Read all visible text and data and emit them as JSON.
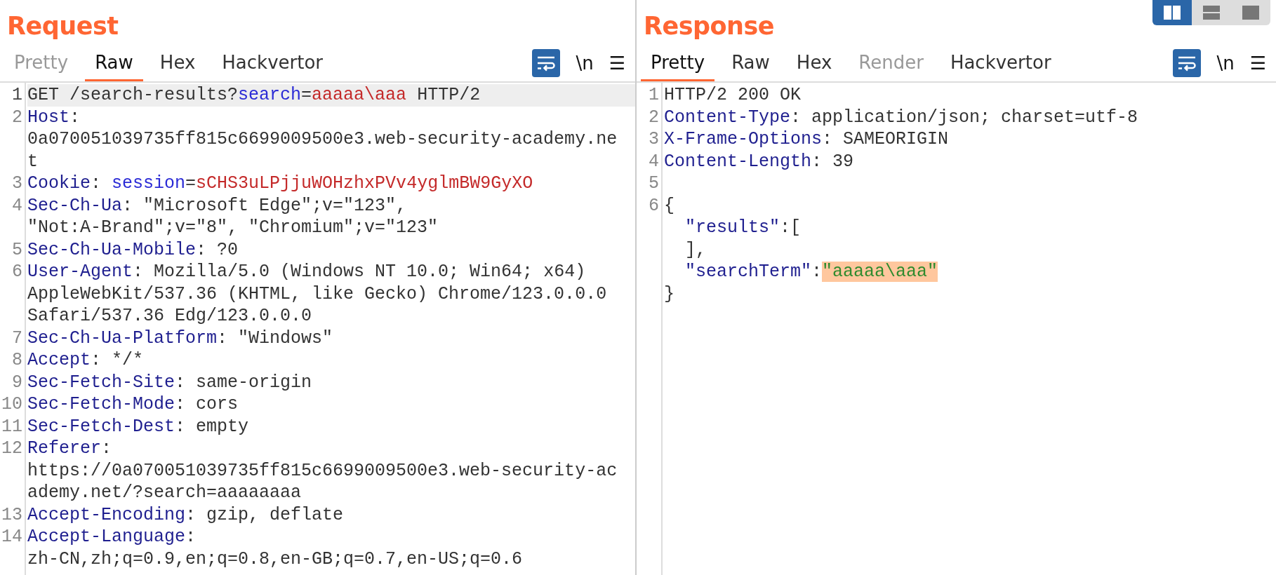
{
  "layout_buttons": [
    {
      "kind": "columns",
      "selected": true
    },
    {
      "kind": "rows",
      "selected": false
    },
    {
      "kind": "single",
      "selected": false
    }
  ],
  "panes": [
    {
      "title": "Request",
      "tabs": [
        {
          "label": "Pretty",
          "selected": false,
          "disabled": true
        },
        {
          "label": "Raw",
          "selected": true,
          "disabled": false
        },
        {
          "label": "Hex",
          "selected": false,
          "disabled": false
        },
        {
          "label": "Hackvertor",
          "selected": false,
          "disabled": false
        }
      ],
      "toolbar": {
        "word_wrap": true,
        "newline_label": "\\n",
        "menu_label": "☰"
      },
      "lines": [
        {
          "number": "1",
          "selected": true,
          "rows": [
            {
              "spans": [
                {
                  "kind": "plain",
                  "text": "GET /search-results?"
                },
                {
                  "kind": "param",
                  "text": "search"
                },
                {
                  "kind": "plain",
                  "text": "="
                },
                {
                  "kind": "value",
                  "text": "aaaaa\\aaa"
                },
                {
                  "kind": "plain",
                  "text": " HTTP/2"
                }
              ]
            }
          ]
        },
        {
          "number": "2",
          "selected": false,
          "rows": [
            {
              "spans": [
                {
                  "kind": "header",
                  "text": "Host"
                },
                {
                  "kind": "plain",
                  "text": ":"
                }
              ]
            },
            {
              "spans": [
                {
                  "kind": "plain",
                  "text": "0a070051039735ff815c6699009500e3.web-security-academy.ne"
                }
              ]
            },
            {
              "spans": [
                {
                  "kind": "plain",
                  "text": "t"
                }
              ]
            }
          ]
        },
        {
          "number": "3",
          "selected": false,
          "rows": [
            {
              "spans": [
                {
                  "kind": "header",
                  "text": "Cookie"
                },
                {
                  "kind": "plain",
                  "text": ": "
                },
                {
                  "kind": "param",
                  "text": "session"
                },
                {
                  "kind": "plain",
                  "text": "="
                },
                {
                  "kind": "value",
                  "text": "sCHS3uLPjjuWOHzhxPVv4yglmBW9GyXO"
                }
              ]
            }
          ]
        },
        {
          "number": "4",
          "selected": false,
          "rows": [
            {
              "spans": [
                {
                  "kind": "header",
                  "text": "Sec-Ch-Ua"
                },
                {
                  "kind": "plain",
                  "text": ": \"Microsoft Edge\";v=\"123\","
                }
              ]
            },
            {
              "spans": [
                {
                  "kind": "plain",
                  "text": "\"Not:A-Brand\";v=\"8\", \"Chromium\";v=\"123\""
                }
              ]
            }
          ]
        },
        {
          "number": "5",
          "selected": false,
          "rows": [
            {
              "spans": [
                {
                  "kind": "header",
                  "text": "Sec-Ch-Ua-Mobile"
                },
                {
                  "kind": "plain",
                  "text": ": ?0"
                }
              ]
            }
          ]
        },
        {
          "number": "6",
          "selected": false,
          "rows": [
            {
              "spans": [
                {
                  "kind": "header",
                  "text": "User-Agent"
                },
                {
                  "kind": "plain",
                  "text": ": Mozilla/5.0 (Windows NT 10.0; Win64; x64)"
                }
              ]
            },
            {
              "spans": [
                {
                  "kind": "plain",
                  "text": "AppleWebKit/537.36 (KHTML, like Gecko) Chrome/123.0.0.0"
                }
              ]
            },
            {
              "spans": [
                {
                  "kind": "plain",
                  "text": "Safari/537.36 Edg/123.0.0.0"
                }
              ]
            }
          ]
        },
        {
          "number": "7",
          "selected": false,
          "rows": [
            {
              "spans": [
                {
                  "kind": "header",
                  "text": "Sec-Ch-Ua-Platform"
                },
                {
                  "kind": "plain",
                  "text": ": \"Windows\""
                }
              ]
            }
          ]
        },
        {
          "number": "8",
          "selected": false,
          "rows": [
            {
              "spans": [
                {
                  "kind": "header",
                  "text": "Accept"
                },
                {
                  "kind": "plain",
                  "text": ": */*"
                }
              ]
            }
          ]
        },
        {
          "number": "9",
          "selected": false,
          "rows": [
            {
              "spans": [
                {
                  "kind": "header",
                  "text": "Sec-Fetch-Site"
                },
                {
                  "kind": "plain",
                  "text": ": same-origin"
                }
              ]
            }
          ]
        },
        {
          "number": "10",
          "selected": false,
          "rows": [
            {
              "spans": [
                {
                  "kind": "header",
                  "text": "Sec-Fetch-Mode"
                },
                {
                  "kind": "plain",
                  "text": ": cors"
                }
              ]
            }
          ]
        },
        {
          "number": "11",
          "selected": false,
          "rows": [
            {
              "spans": [
                {
                  "kind": "header",
                  "text": "Sec-Fetch-Dest"
                },
                {
                  "kind": "plain",
                  "text": ": empty"
                }
              ]
            }
          ]
        },
        {
          "number": "12",
          "selected": false,
          "rows": [
            {
              "spans": [
                {
                  "kind": "header",
                  "text": "Referer"
                },
                {
                  "kind": "plain",
                  "text": ":"
                }
              ]
            },
            {
              "spans": [
                {
                  "kind": "plain",
                  "text": "https://0a070051039735ff815c6699009500e3.web-security-ac"
                }
              ]
            },
            {
              "spans": [
                {
                  "kind": "plain",
                  "text": "ademy.net/?search=aaaaaaaa"
                }
              ]
            }
          ]
        },
        {
          "number": "13",
          "selected": false,
          "rows": [
            {
              "spans": [
                {
                  "kind": "header",
                  "text": "Accept-Encoding"
                },
                {
                  "kind": "plain",
                  "text": ": gzip, deflate"
                }
              ]
            }
          ]
        },
        {
          "number": "14",
          "selected": false,
          "rows": [
            {
              "spans": [
                {
                  "kind": "header",
                  "text": "Accept-Language"
                },
                {
                  "kind": "plain",
                  "text": ":"
                }
              ]
            },
            {
              "spans": [
                {
                  "kind": "plain",
                  "text": "zh-CN,zh;q=0.9,en;q=0.8,en-GB;q=0.7,en-US;q=0.6"
                }
              ]
            }
          ]
        }
      ]
    },
    {
      "title": "Response",
      "tabs": [
        {
          "label": "Pretty",
          "selected": true,
          "disabled": false
        },
        {
          "label": "Raw",
          "selected": false,
          "disabled": false
        },
        {
          "label": "Hex",
          "selected": false,
          "disabled": false
        },
        {
          "label": "Render",
          "selected": false,
          "disabled": true
        },
        {
          "label": "Hackvertor",
          "selected": false,
          "disabled": false
        }
      ],
      "toolbar": {
        "word_wrap": true,
        "newline_label": "\\n",
        "menu_label": "☰"
      },
      "lines": [
        {
          "number": "1",
          "selected": false,
          "rows": [
            {
              "spans": [
                {
                  "kind": "plain",
                  "text": "HTTP/2 200 OK"
                }
              ]
            }
          ]
        },
        {
          "number": "2",
          "selected": false,
          "rows": [
            {
              "spans": [
                {
                  "kind": "header",
                  "text": "Content-Type"
                },
                {
                  "kind": "plain",
                  "text": ": application/json; charset=utf-8"
                }
              ]
            }
          ]
        },
        {
          "number": "3",
          "selected": false,
          "rows": [
            {
              "spans": [
                {
                  "kind": "header",
                  "text": "X-Frame-Options"
                },
                {
                  "kind": "plain",
                  "text": ": SAMEORIGIN"
                }
              ]
            }
          ]
        },
        {
          "number": "4",
          "selected": false,
          "rows": [
            {
              "spans": [
                {
                  "kind": "header",
                  "text": "Content-Length"
                },
                {
                  "kind": "plain",
                  "text": ": 39"
                }
              ]
            }
          ]
        },
        {
          "number": "5",
          "selected": false,
          "rows": [
            {
              "spans": []
            }
          ]
        },
        {
          "number": "6",
          "selected": false,
          "rows": [
            {
              "spans": [
                {
                  "kind": "plain",
                  "text": "{"
                }
              ]
            },
            {
              "indented": true,
              "spans": [
                {
                  "kind": "header",
                  "text": "\"results\""
                },
                {
                  "kind": "plain",
                  "text": ":["
                }
              ]
            },
            {
              "indented": true,
              "spans": [
                {
                  "kind": "plain",
                  "text": "],"
                }
              ]
            },
            {
              "indented": true,
              "spans": [
                {
                  "kind": "header",
                  "text": "\"searchTerm\""
                },
                {
                  "kind": "plain",
                  "text": ":"
                },
                {
                  "kind": "highlighted-string",
                  "text": "\"aaaaa\\aaa\""
                }
              ]
            },
            {
              "spans": [
                {
                  "kind": "plain",
                  "text": "}"
                }
              ]
            }
          ]
        }
      ]
    }
  ]
}
